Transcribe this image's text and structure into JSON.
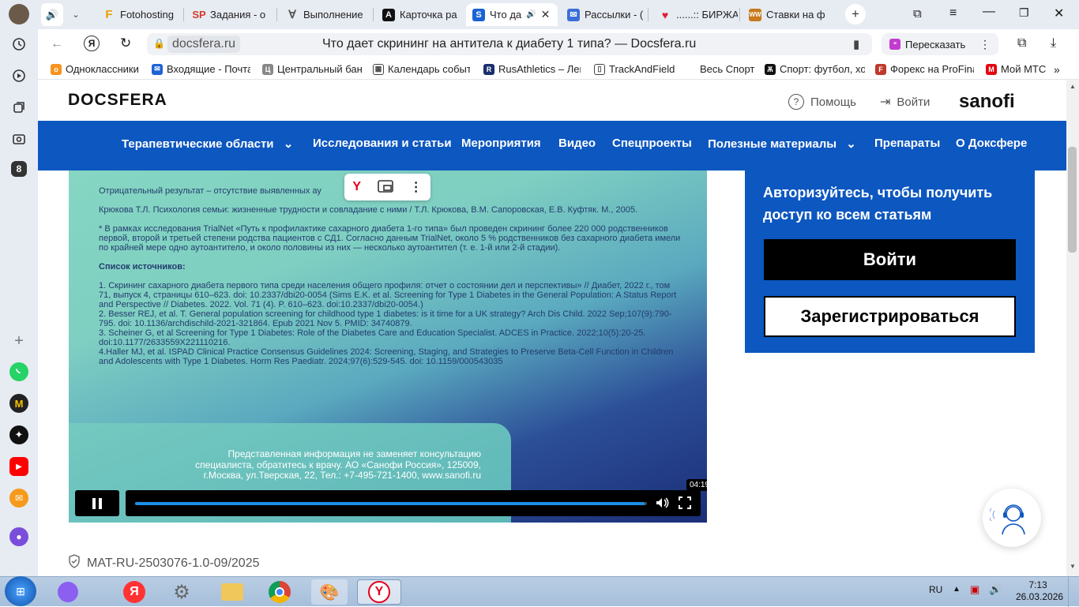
{
  "browser": {
    "tabs": [
      {
        "label": "",
        "icon": "speaker-icon"
      },
      {
        "label": "Fotohosting",
        "icon": "F"
      },
      {
        "label": "Задания - о",
        "icon": "SP"
      },
      {
        "label": "Выполнение",
        "icon": "V"
      },
      {
        "label": "Карточка ра",
        "icon": "A"
      },
      {
        "label": "Что да",
        "icon": "docsfera"
      },
      {
        "label": "Рассылки - (",
        "icon": "mail"
      },
      {
        "label": "......:: БИРЖА",
        "icon": "heart"
      },
      {
        "label": "Ставки на ф",
        "icon": "WW"
      }
    ],
    "domain": "docsfera.ru",
    "page_title": "Что дает скрининг на антитела к диабету 1 типа? — Docsfera.ru",
    "retell_label": "Пересказать",
    "bookmarks": [
      "Одноклассники",
      "Входящие - Почта",
      "Центральный бан",
      "Календарь событ",
      "RusAthletics – Лег",
      "TrackAndField",
      "Весь Спорт",
      "Спорт: футбол, хо",
      "Форекс на ProFina",
      "Мой МТС"
    ],
    "left_badge": "8"
  },
  "site": {
    "logo": "DOCSFERA",
    "help": "Помощь",
    "login": "Войти",
    "partner_logo": "sanofi",
    "nav": [
      "Терапевтические области",
      "Исследования и статьи",
      "Мероприятия",
      "Видео",
      "Спецпроекты",
      "Полезные материалы",
      "Препараты",
      "О Доксфере"
    ]
  },
  "video": {
    "negative_result": "Отрицательный результат – отсутствие выявленных ау",
    "ref_krukova": "Крюкова Т.Л. Психология семьи: жизненные трудности и совладание с ними / Т.Л. Крюкова, В.М. Сапоровская, Е.В. Куфтяк. М., 2005.",
    "trialnet_note": "* В рамках исследования TrialNet «Путь к профилактике сахарного диабета 1-го типа» был проведен скрининг более 220 000 родственников первой, второй и третьей степени родства пациентов с СД1. Согласно данным TrialNet, около 5 % родственников без сахарного диабета имели по крайней мере одно аутоантитело, и около половины из них — несколько аутоантител (т. е. 1-й или 2-й стадии).",
    "sources_title": "Список источников:",
    "sources": [
      "1. Скрининг сахарного диабета первого типа среди населения общего профиля: отчет о состоянии дел и перспективы» // Диабет, 2022 г., том 71, выпуск 4, страницы 610–623. doi: 10.2337/dbi20-0054 (Sims E.K. et al. Screening for Type 1 Diabetes in the General Population: A Status Report and Perspective // Diabetes. 2022. Vol. 71 (4). P. 610–623. doi:10.2337/dbi20-0054.)",
      "2. Besser REJ, et al. T. General population screening for childhood type 1 diabetes: is it time for a UK strategy? Arch Dis Child. 2022 Sep;107(9):790-795. doi: 10.1136/archdischild-2021-321864. Epub 2021 Nov 5. PMID: 34740879.",
      "3. Scheiner G, et al Screening for Type 1 Diabetes: Role of the Diabetes Care and Education Specialist. ADCES in Practice. 2022;10(5):20-25. doi:10.1177/2633559X221110216.",
      "4.Haller MJ, et al. ISPAD Clinical Practice Consensus Guidelines 2024: Screening, Staging, and Strategies to Preserve Beta-Cell Function in Children and Adolescents with Type 1 Diabetes. Horm Res Paediatr. 2024;97(6):529-545. doi: 10.1159/000543035"
    ],
    "disclaimer": "Представленная информация не заменяет консультацию специалиста, обратитесь к врачу. АО «Санофи Россия», 125009, г.Москва, ул.Тверская, 22, Тел.: +7-495-721-1400, www.sanofi.ru",
    "time_tooltip": "04:19",
    "progress_fraction": 0.995
  },
  "auth": {
    "title": "Авторизуйтесь, чтобы получить доступ ко всем статьям",
    "login_button": "Войти",
    "register_button": "Зарегистрироваться"
  },
  "material_code": "MAT-RU-2503076-1.0-09/2025",
  "taskbar": {
    "lang": "RU",
    "time": "7:13",
    "date": "26.03.2026"
  }
}
